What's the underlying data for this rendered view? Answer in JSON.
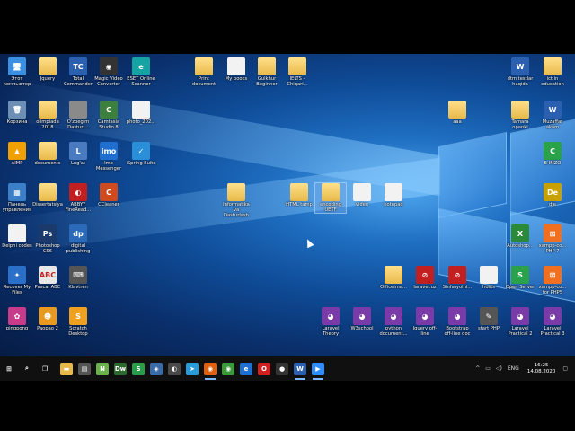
{
  "desktop_icons": [
    {
      "id": "this-pc",
      "label": "Этот компьютер",
      "kind": "app",
      "glyph": "🖥",
      "color": "#3a8fe0"
    },
    {
      "id": "jquery",
      "label": "Jquery",
      "kind": "folder",
      "glyph": "",
      "color": "#e8b94a"
    },
    {
      "id": "total-commander",
      "label": "Total Commander",
      "kind": "app",
      "glyph": "TC",
      "color": "#2b5fb0"
    },
    {
      "id": "magic-video",
      "label": "Magic Video Converter",
      "kind": "app",
      "glyph": "◉",
      "color": "#333333"
    },
    {
      "id": "eset",
      "label": "ESET Online Scanner",
      "kind": "app",
      "glyph": "e",
      "color": "#16a3a3"
    },
    {
      "id": "print-document",
      "label": "Print document",
      "kind": "folder",
      "glyph": "",
      "color": "#e8b94a"
    },
    {
      "id": "my-books",
      "label": "My books",
      "kind": "file",
      "glyph": "",
      "color": "#f2f2f2"
    },
    {
      "id": "gulkhur",
      "label": "Gulkhur Beginner",
      "kind": "folder",
      "glyph": "",
      "color": "#e8b94a"
    },
    {
      "id": "ielts",
      "label": "IELTS - Chiqari...",
      "kind": "folder",
      "glyph": "",
      "color": "#e8b94a"
    },
    {
      "id": "dtm",
      "label": "dtm testlar haqida",
      "kind": "app",
      "glyph": "W",
      "color": "#2b5fb0"
    },
    {
      "id": "ict",
      "label": "ict in education",
      "kind": "folder",
      "glyph": "",
      "color": "#e8b94a"
    },
    {
      "id": "recycle",
      "label": "Корзина",
      "kind": "app",
      "glyph": "🗑",
      "color": "#6d8fb5"
    },
    {
      "id": "olimpiada",
      "label": "olimpiada 2018",
      "kind": "folder",
      "glyph": "",
      "color": "#e8b94a"
    },
    {
      "id": "obegim",
      "label": "O'zbegim Dasturi...",
      "kind": "app",
      "glyph": "",
      "color": "#8a8a8a"
    },
    {
      "id": "camtasia",
      "label": "Camtasia Studio 8",
      "kind": "app",
      "glyph": "C",
      "color": "#3d7f3d"
    },
    {
      "id": "photo",
      "label": "photo_202...",
      "kind": "file",
      "glyph": "",
      "color": "#bbbbbb"
    },
    {
      "id": "aaa",
      "label": "aaa",
      "kind": "folder",
      "glyph": "",
      "color": "#e8b94a"
    },
    {
      "id": "tamara",
      "label": "Tamara opanki",
      "kind": "folder",
      "glyph": "",
      "color": "#e8b94a"
    },
    {
      "id": "muzaffar",
      "label": "Muzaffar akam",
      "kind": "app",
      "glyph": "W",
      "color": "#2b5fb0"
    },
    {
      "id": "aimp",
      "label": "AIMP",
      "kind": "app",
      "glyph": "▲",
      "color": "#f0a000"
    },
    {
      "id": "documents",
      "label": "documents",
      "kind": "folder",
      "glyph": "",
      "color": "#e8b94a"
    },
    {
      "id": "lugat",
      "label": "Lug'at",
      "kind": "app",
      "glyph": "L",
      "color": "#4a7ac0"
    },
    {
      "id": "imo",
      "label": "Imo Messenger",
      "kind": "app",
      "glyph": "imo",
      "color": "#1e6fd0"
    },
    {
      "id": "ispring",
      "label": "iSpring Suite",
      "kind": "app",
      "glyph": "✓",
      "color": "#2a8fd8"
    },
    {
      "id": "eimzo",
      "label": "E-IMZO",
      "kind": "app",
      "glyph": "C",
      "color": "#2aa24a"
    },
    {
      "id": "control-panel",
      "label": "Панель управления",
      "kind": "app",
      "glyph": "▦",
      "color": "#3a7fc8"
    },
    {
      "id": "dissertatsiya",
      "label": "Dissertatsiya",
      "kind": "folder",
      "glyph": "",
      "color": "#e8b94a"
    },
    {
      "id": "abbyy",
      "label": "ABBYY FineRead...",
      "kind": "app",
      "glyph": "◐",
      "color": "#c22020"
    },
    {
      "id": "ccleaner",
      "label": "CCleaner",
      "kind": "app",
      "glyph": "C",
      "color": "#d04a20"
    },
    {
      "id": "informatika",
      "label": "Informatika va Dasturlash",
      "kind": "folder",
      "glyph": "",
      "color": "#e8b94a"
    },
    {
      "id": "html-tamp",
      "label": "HTML tamp",
      "kind": "folder",
      "glyph": "",
      "color": "#e8b94a"
    },
    {
      "id": "encoding",
      "label": "encoding UETF",
      "kind": "folder",
      "glyph": "",
      "color": "#e8b94a"
    },
    {
      "id": "video",
      "label": "video",
      "kind": "file",
      "glyph": "",
      "color": "#f2f2f2"
    },
    {
      "id": "notepad",
      "label": "notepad",
      "kind": "file",
      "glyph": "",
      "color": "#f2f2f2"
    },
    {
      "id": "die",
      "label": "die",
      "kind": "app",
      "glyph": "De",
      "color": "#c8a000"
    },
    {
      "id": "delphi",
      "label": "Delphi codes",
      "kind": "file",
      "glyph": "",
      "color": "#f2f2f2"
    },
    {
      "id": "photoshop",
      "label": "Photoshop CS6",
      "kind": "app",
      "glyph": "Ps",
      "color": "#1b3a6b"
    },
    {
      "id": "digital",
      "label": "digital publishing",
      "kind": "app",
      "glyph": "dp",
      "color": "#2a6ab8"
    },
    {
      "id": "autoshop",
      "label": "Autoshop...",
      "kind": "app",
      "glyph": "X",
      "color": "#2a8a3a"
    },
    {
      "id": "xampp7",
      "label": "xampp-co... PHP 7",
      "kind": "app",
      "glyph": "⊠",
      "color": "#f07020"
    },
    {
      "id": "recover",
      "label": "Recover My Files",
      "kind": "app",
      "glyph": "✦",
      "color": "#2a70c8"
    },
    {
      "id": "pascal",
      "label": "Pascal ABC",
      "kind": "app",
      "glyph": "ABC",
      "color": "#e8e8e8"
    },
    {
      "id": "klavtren",
      "label": "Klavtren",
      "kind": "app",
      "glyph": "⌨",
      "color": "#555555"
    },
    {
      "id": "officeima",
      "label": "Officeima...",
      "kind": "folder",
      "glyph": "",
      "color": "#e8b94a"
    },
    {
      "id": "laravel-uz",
      "label": "laravel.uz",
      "kind": "app",
      "glyph": "⊘",
      "color": "#c22020"
    },
    {
      "id": "sinfaryo",
      "label": "Sinfaryolni...",
      "kind": "app",
      "glyph": "⊘",
      "color": "#c22020"
    },
    {
      "id": "hosts",
      "label": "hosts",
      "kind": "file",
      "glyph": "",
      "color": "#f2f2f2"
    },
    {
      "id": "open-server",
      "label": "Open Server",
      "kind": "app",
      "glyph": "S",
      "color": "#2aa24a"
    },
    {
      "id": "xampp5",
      "label": "xampp-co... for PHP5",
      "kind": "app",
      "glyph": "⊠",
      "color": "#f07020"
    },
    {
      "id": "pingpong",
      "label": "pingpong",
      "kind": "app",
      "glyph": "✿",
      "color": "#c83a8a"
    },
    {
      "id": "paopao",
      "label": "Paopao 2",
      "kind": "app",
      "glyph": "☻",
      "color": "#e89a20"
    },
    {
      "id": "scratch",
      "label": "Scratch Desktop",
      "kind": "app",
      "glyph": "S",
      "color": "#f0a020"
    },
    {
      "id": "laravel-theory",
      "label": "Laravel Theory",
      "kind": "app",
      "glyph": "◕",
      "color": "#7a3aa8"
    },
    {
      "id": "w3school",
      "label": "W3school",
      "kind": "app",
      "glyph": "◕",
      "color": "#7a3aa8"
    },
    {
      "id": "python-doc",
      "label": "python document...",
      "kind": "app",
      "glyph": "◕",
      "color": "#7a3aa8"
    },
    {
      "id": "jquery-offline",
      "label": "Jquery off-line",
      "kind": "app",
      "glyph": "◕",
      "color": "#7a3aa8"
    },
    {
      "id": "bootstrap",
      "label": "Bootstrap off-line doc",
      "kind": "app",
      "glyph": "◕",
      "color": "#7a3aa8"
    },
    {
      "id": "start-php",
      "label": "start PHP",
      "kind": "app",
      "glyph": "✎",
      "color": "#555555"
    },
    {
      "id": "laravel-p2",
      "label": "Laravel Practical 2",
      "kind": "app",
      "glyph": "◕",
      "color": "#7a3aa8"
    },
    {
      "id": "laravel-p3",
      "label": "Laravel Practical 3",
      "kind": "app",
      "glyph": "◕",
      "color": "#7a3aa8"
    }
  ],
  "taskbar": {
    "apps": [
      {
        "id": "start",
        "glyph": "⊞",
        "color": "#101010",
        "active": false
      },
      {
        "id": "search",
        "glyph": "⌕",
        "color": "#101010",
        "active": false
      },
      {
        "id": "task-view",
        "glyph": "❐",
        "color": "#101010",
        "active": false
      },
      {
        "id": "explorer",
        "glyph": "▬",
        "color": "#e8b94a",
        "active": false
      },
      {
        "id": "store",
        "glyph": "▤",
        "color": "#555555",
        "active": false
      },
      {
        "id": "notepad-pp",
        "glyph": "N",
        "color": "#6ab04c",
        "active": false
      },
      {
        "id": "dreamweaver",
        "glyph": "Dw",
        "color": "#2d6a2d",
        "active": false
      },
      {
        "id": "skype",
        "glyph": "S",
        "color": "#2a9d4a",
        "active": false
      },
      {
        "id": "messenger",
        "glyph": "◈",
        "color": "#3a6aa8",
        "active": false
      },
      {
        "id": "people",
        "glyph": "◐",
        "color": "#4a4a4a",
        "active": false
      },
      {
        "id": "telegram",
        "glyph": "➤",
        "color": "#2a9ad8",
        "active": false
      },
      {
        "id": "firefox",
        "glyph": "◉",
        "color": "#e06010",
        "active": true
      },
      {
        "id": "chrome",
        "glyph": "◉",
        "color": "#3a9a3a",
        "active": false
      },
      {
        "id": "edge",
        "glyph": "e",
        "color": "#1e6fd0",
        "active": false
      },
      {
        "id": "opera",
        "glyph": "O",
        "color": "#d02020",
        "active": false
      },
      {
        "id": "obs",
        "glyph": "●",
        "color": "#333333",
        "active": false
      },
      {
        "id": "word",
        "glyph": "W",
        "color": "#2b5fb0",
        "active": true
      },
      {
        "id": "zoom",
        "glyph": "▶",
        "color": "#2d8cff",
        "active": true
      }
    ],
    "tray": {
      "language": "ENG",
      "time": "16:25",
      "date": "14.08.2020"
    }
  }
}
